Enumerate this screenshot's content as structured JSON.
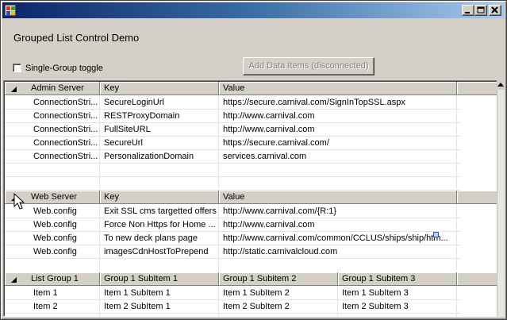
{
  "window": {
    "controls": {
      "minimize": "0",
      "maximize": "1",
      "close": "r"
    }
  },
  "page": {
    "title": "Grouped List Control Demo"
  },
  "single_group_toggle": {
    "label": "Single-Group toggle",
    "checked": false
  },
  "add_button": {
    "label": "Add Data Items (disconnected)",
    "enabled": false
  },
  "groups": [
    {
      "headers": [
        "Admin Server",
        "Key",
        "Value"
      ],
      "rows": [
        [
          "ConnectionStri...",
          "SecureLoginUrl",
          "https://secure.carnival.com/SignInTopSSL.aspx"
        ],
        [
          "ConnectionStri...",
          "RESTProxyDomain",
          "http://www.carnival.com"
        ],
        [
          "ConnectionStri...",
          "FullSiteURL",
          "http://www.carnival.com"
        ],
        [
          "ConnectionStri...",
          "SecureUrl",
          "https://secure.carnival.com/"
        ],
        [
          "ConnectionStri...",
          "PersonalizationDomain",
          "services.carnival.com"
        ]
      ]
    },
    {
      "headers": [
        "Web Server",
        "Key",
        "Value"
      ],
      "rows": [
        [
          "Web.config",
          "Exit SSL cms targetted offers",
          "http://www.carnival.com/{R:1}"
        ],
        [
          "Web.config",
          "Force Non Https for Home ...",
          "http://www.carnival.com"
        ],
        [
          "Web.config",
          "To new deck plans page",
          "http://www.carnival.com/common/CCLUS/ships/ship/htm..."
        ],
        [
          "Web.config",
          "imagesCdnHostToPrepend",
          "http://static.carnivalcloud.com"
        ]
      ]
    },
    {
      "headers": [
        "List Group 1",
        "Group 1 SubItem 1",
        "Group 1 Subitem 2",
        "Group 1 Subitem 3"
      ],
      "rows": [
        [
          "Item 1",
          "Item 1 SubItem 1",
          "Item 1 SubItem 2",
          "Item 1 SubItem 3"
        ],
        [
          "Item 2",
          "Item 2 SubItem 1",
          "Item 2 SubItem 2",
          "Item 2 SubItem 3"
        ]
      ]
    }
  ]
}
